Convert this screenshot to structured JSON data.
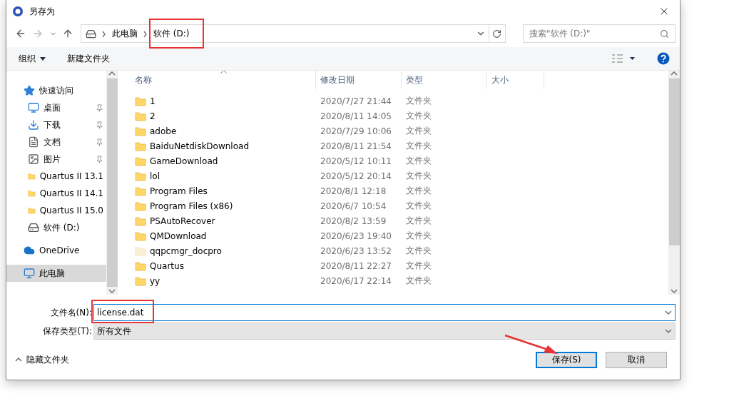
{
  "window": {
    "title": "另存为"
  },
  "address": {
    "crumbs": [
      {
        "label": "此电脑"
      },
      {
        "label": "软件 (D:)"
      }
    ],
    "highlighted": true
  },
  "search": {
    "placeholder": "搜索\"软件 (D:)\""
  },
  "toolbar": {
    "organize": "组织",
    "new_folder": "新建文件夹"
  },
  "sidebar": {
    "items": [
      {
        "label": "快速访问",
        "kind": "star",
        "selected": false,
        "children": [
          {
            "label": "桌面",
            "kind": "desktop",
            "pinned": true,
            "selected": false
          },
          {
            "label": "下载",
            "kind": "download",
            "pinned": true,
            "selected": false
          },
          {
            "label": "文档",
            "kind": "document",
            "pinned": true,
            "selected": false
          },
          {
            "label": "图片",
            "kind": "picture",
            "pinned": true,
            "selected": false
          },
          {
            "label": "Quartus II 13.1",
            "kind": "folder",
            "pinned": false,
            "selected": false
          },
          {
            "label": "Quartus II 14.1",
            "kind": "folder",
            "pinned": false,
            "selected": false
          },
          {
            "label": "Quartus II 15.0",
            "kind": "folder",
            "pinned": false,
            "selected": false
          },
          {
            "label": "软件 (D:)",
            "kind": "drive",
            "pinned": false,
            "selected": false
          }
        ]
      },
      {
        "label": "OneDrive",
        "kind": "cloud",
        "selected": false
      },
      {
        "label": "此电脑",
        "kind": "pc",
        "selected": true
      }
    ]
  },
  "table": {
    "columns": [
      {
        "label": "名称",
        "sorted": true
      },
      {
        "label": "修改日期",
        "sorted": false
      },
      {
        "label": "类型",
        "sorted": false
      },
      {
        "label": "大小",
        "sorted": false
      }
    ],
    "rows": [
      {
        "name": "1",
        "date": "2020/7/27 21:44",
        "type": "文件夹",
        "hidden": false
      },
      {
        "name": "2",
        "date": "2020/8/11 14:05",
        "type": "文件夹",
        "hidden": false
      },
      {
        "name": "adobe",
        "date": "2020/7/29 10:06",
        "type": "文件夹",
        "hidden": false
      },
      {
        "name": "BaiduNetdiskDownload",
        "date": "2020/8/11 21:54",
        "type": "文件夹",
        "hidden": false
      },
      {
        "name": "GameDownload",
        "date": "2020/5/12 10:11",
        "type": "文件夹",
        "hidden": false
      },
      {
        "name": "lol",
        "date": "2020/5/12 20:14",
        "type": "文件夹",
        "hidden": false
      },
      {
        "name": "Program Files",
        "date": "2020/8/1 12:18",
        "type": "文件夹",
        "hidden": false
      },
      {
        "name": "Program Files (x86)",
        "date": "2020/6/7 10:54",
        "type": "文件夹",
        "hidden": false
      },
      {
        "name": "PSAutoRecover",
        "date": "2020/8/2 13:59",
        "type": "文件夹",
        "hidden": false
      },
      {
        "name": "QMDownload",
        "date": "2020/6/23 19:40",
        "type": "文件夹",
        "hidden": false
      },
      {
        "name": "qqpcmgr_docpro",
        "date": "2020/6/23 13:52",
        "type": "文件夹",
        "hidden": true
      },
      {
        "name": "Quartus",
        "date": "2020/8/11 22:27",
        "type": "文件夹",
        "hidden": false
      },
      {
        "name": "yy",
        "date": "2020/6/17 22:14",
        "type": "文件夹",
        "hidden": false
      }
    ]
  },
  "filename": {
    "label": "文件名(N):",
    "value": "license.dat",
    "highlighted": true
  },
  "filetype": {
    "label": "保存类型(T):",
    "value": "所有文件"
  },
  "footer": {
    "hide_folders": "隐藏文件夹",
    "buttons": [
      {
        "label": "保存(S)",
        "kind": "primary",
        "pointed": true
      },
      {
        "label": "取消",
        "kind": "normal",
        "pointed": false
      }
    ]
  }
}
